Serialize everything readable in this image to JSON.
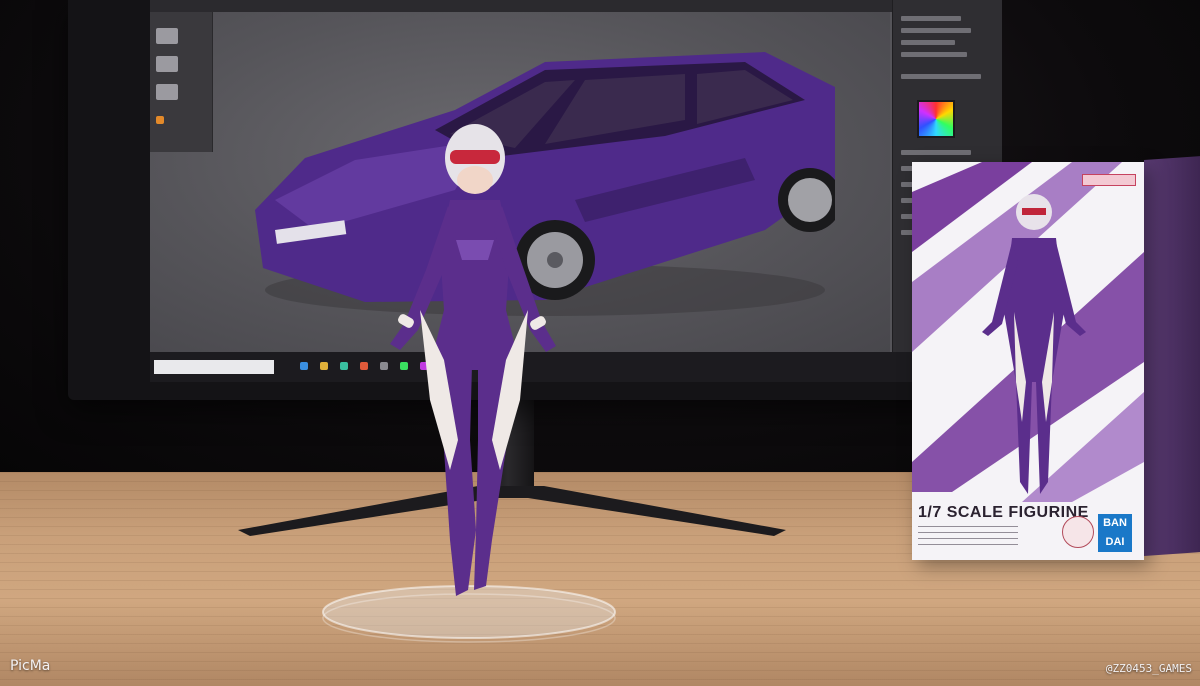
{
  "scene": {
    "box_title": "1/7 SCALE FIGURINE",
    "box_brand": "BAN DAI",
    "box_spine_text": "",
    "watermark_left": "PicMa",
    "watermark_right": "@ZZ0453_GAMES"
  },
  "colors": {
    "figure_purple": "#5b2e8c",
    "figure_white": "#efe9e6",
    "car_purple": "#4f2a8a",
    "desk_wood": "#c9a07a",
    "brand_blue": "#1a78c8"
  }
}
